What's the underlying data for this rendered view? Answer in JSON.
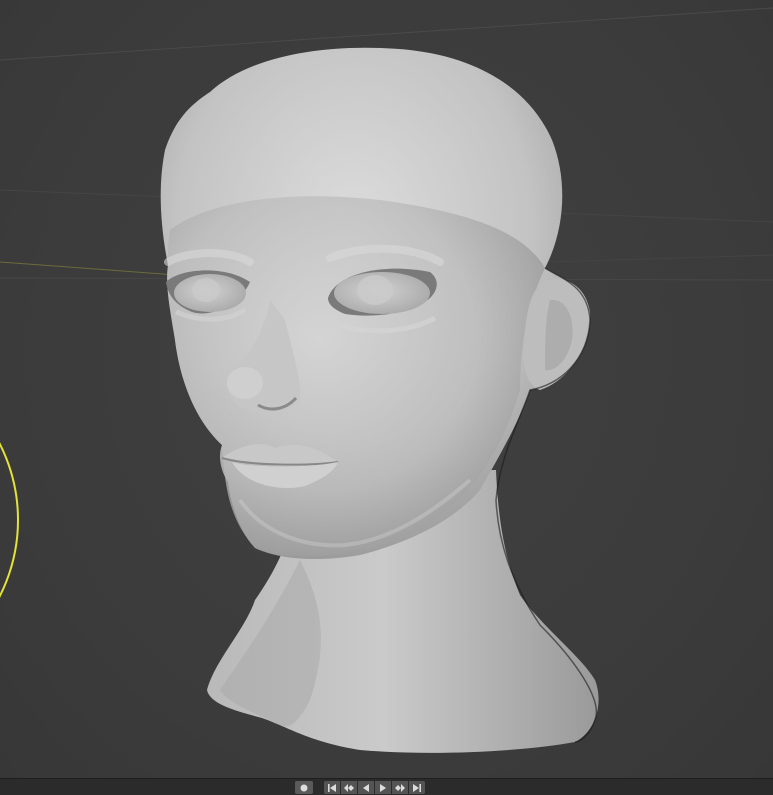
{
  "app": "3D Viewport",
  "colors": {
    "background": "#3d3d3d",
    "mesh": "#c4c4c4",
    "selection_ring": "#e6e635",
    "timeline_bg": "#2b2b2b",
    "button_bg": "#545454"
  },
  "viewport": {
    "object": "sculpted-head-mesh",
    "shading": "solid",
    "active_circle": "brush-radius"
  },
  "timeline": {
    "controls": [
      {
        "name": "record",
        "icon": "record-icon"
      },
      {
        "name": "jump-to-start",
        "icon": "jump-start-icon"
      },
      {
        "name": "jump-to-keyframe-prev",
        "icon": "prev-keyframe-icon"
      },
      {
        "name": "play-reverse",
        "icon": "play-reverse-icon"
      },
      {
        "name": "play",
        "icon": "play-icon"
      },
      {
        "name": "jump-to-keyframe-next",
        "icon": "next-keyframe-icon"
      },
      {
        "name": "jump-to-end",
        "icon": "jump-end-icon"
      }
    ]
  }
}
